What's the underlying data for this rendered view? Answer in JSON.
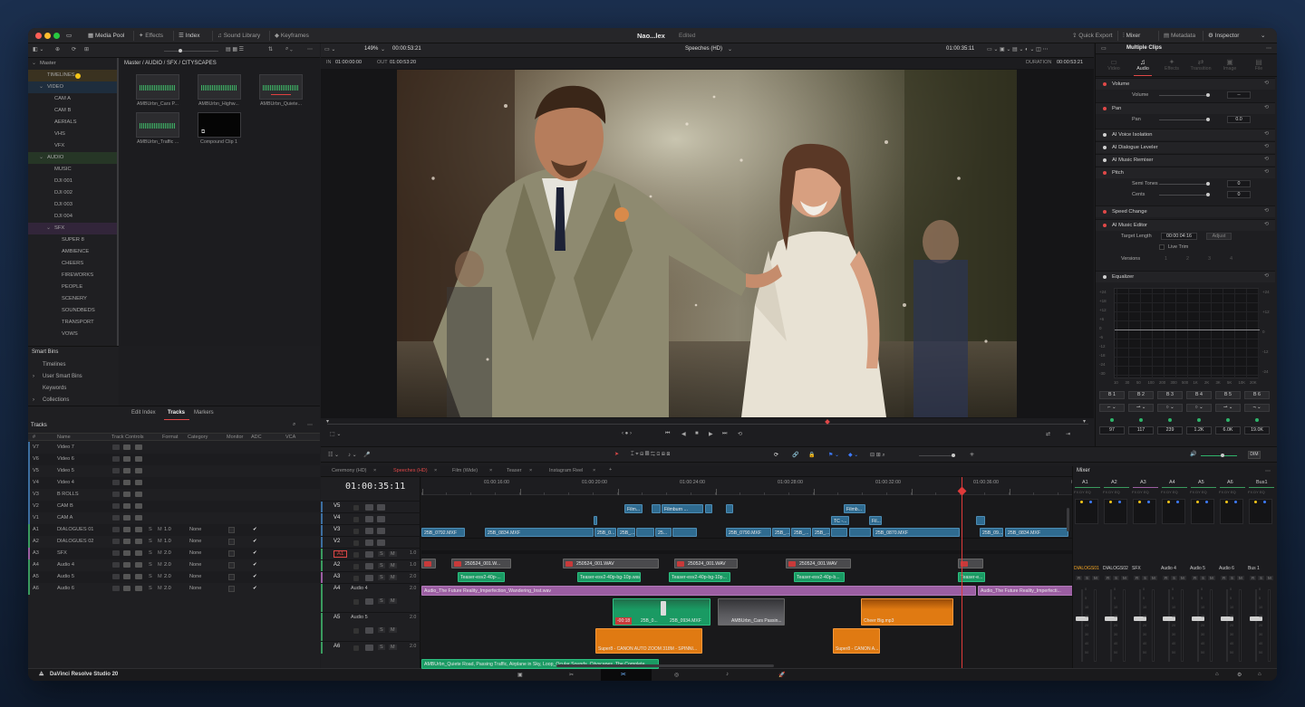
{
  "app": {
    "project_name": "Nao...lex",
    "status": "Edited",
    "brand": "DaVinci Resolve Studio 20"
  },
  "topbar": {
    "left": [
      "Media Pool",
      "Effects",
      "Index",
      "Sound Library",
      "Keyframes"
    ],
    "right": [
      "Quick Export",
      "Mixer",
      "Metadata",
      "Inspector"
    ]
  },
  "viewer": {
    "zoom": "149%",
    "timecode_in": "00:00:53:21",
    "timeline_name": "Speeches (HD)",
    "timecode_current": "01:00:35:11",
    "in_label": "IN",
    "in_tc": "01:00:00:00",
    "out_label": "OUT",
    "out_tc": "01:00:53:20",
    "duration_label": "DURATION",
    "duration_tc": "00:00:53:21"
  },
  "media_pool": {
    "breadcrumb": "Master / AUDIO / SFX / CITYSCAPES",
    "tree": [
      {
        "label": "Master",
        "indent": 0,
        "arrow": "v",
        "color": ""
      },
      {
        "label": "TIMELINES",
        "indent": 1,
        "arrow": "",
        "color": "#3a3220"
      },
      {
        "label": "VIDEO",
        "indent": 1,
        "arrow": "v",
        "color": "#1e2d3d"
      },
      {
        "label": "CAM A",
        "indent": 2,
        "arrow": "",
        "color": ""
      },
      {
        "label": "CAM B",
        "indent": 2,
        "arrow": "",
        "color": ""
      },
      {
        "label": "AERIALS",
        "indent": 2,
        "arrow": "",
        "color": ""
      },
      {
        "label": "VHS",
        "indent": 2,
        "arrow": "",
        "color": ""
      },
      {
        "label": "VFX",
        "indent": 2,
        "arrow": "",
        "color": ""
      },
      {
        "label": "AUDIO",
        "indent": 1,
        "arrow": "v",
        "color": "#263626"
      },
      {
        "label": "MUSIC",
        "indent": 2,
        "arrow": "",
        "color": ""
      },
      {
        "label": "DJI 001",
        "indent": 2,
        "arrow": "",
        "color": ""
      },
      {
        "label": "DJI 002",
        "indent": 2,
        "arrow": "",
        "color": ""
      },
      {
        "label": "DJI 003",
        "indent": 2,
        "arrow": "",
        "color": ""
      },
      {
        "label": "DJI 004",
        "indent": 2,
        "arrow": "",
        "color": ""
      },
      {
        "label": "SFX",
        "indent": 2,
        "arrow": "v",
        "color": "#32253a"
      },
      {
        "label": "SUPER 8",
        "indent": 3,
        "arrow": "",
        "color": ""
      },
      {
        "label": "AMBIENCE",
        "indent": 3,
        "arrow": "",
        "color": ""
      },
      {
        "label": "CHEERS",
        "indent": 3,
        "arrow": "",
        "color": ""
      },
      {
        "label": "FIREWORKS",
        "indent": 3,
        "arrow": "",
        "color": ""
      },
      {
        "label": "PEOPLE",
        "indent": 3,
        "arrow": "",
        "color": ""
      },
      {
        "label": "SCENERY",
        "indent": 3,
        "arrow": "",
        "color": ""
      },
      {
        "label": "SOUNDBEDS",
        "indent": 3,
        "arrow": "",
        "color": ""
      },
      {
        "label": "TRANSPORT",
        "indent": 3,
        "arrow": "",
        "color": ""
      },
      {
        "label": "VOWS",
        "indent": 3,
        "arrow": "",
        "color": ""
      }
    ],
    "clips": [
      "AMBUrbn_Cars P...",
      "AMBUrbn_Highw...",
      "AMBUrbn_Quiete...",
      "AMBUrbn_Traffic ...",
      "Compound Clip 1"
    ],
    "smart_bins_title": "Smart Bins",
    "smart_bins": [
      "Timelines",
      "User Smart Bins",
      "Keywords",
      "Collections"
    ]
  },
  "index": {
    "tabs": [
      "Edit Index",
      "Tracks",
      "Markers"
    ],
    "active_tab": "Tracks",
    "title": "Tracks",
    "columns": [
      "#",
      "Name",
      "Track Controls",
      "Format",
      "Category",
      "Monitor",
      "ADC",
      "VCA"
    ],
    "rows": [
      {
        "id": "V7",
        "name": "Video 7",
        "format": "",
        "category": "",
        "adc": ""
      },
      {
        "id": "V6",
        "name": "Video 6",
        "format": "",
        "category": "",
        "adc": ""
      },
      {
        "id": "V5",
        "name": "Video 5",
        "format": "",
        "category": "",
        "adc": ""
      },
      {
        "id": "V4",
        "name": "Video 4",
        "format": "",
        "category": "",
        "adc": ""
      },
      {
        "id": "V3",
        "name": "B ROLLS",
        "format": "",
        "category": "",
        "adc": ""
      },
      {
        "id": "V2",
        "name": "CAM B",
        "format": "",
        "category": "",
        "adc": ""
      },
      {
        "id": "V1",
        "name": "CAM A",
        "format": "",
        "category": "",
        "adc": ""
      },
      {
        "id": "A1",
        "name": "DIALOGUES 01",
        "format": "1.0",
        "category": "None",
        "adc": "✔"
      },
      {
        "id": "A2",
        "name": "DIALOGUES 02",
        "format": "1.0",
        "category": "None",
        "adc": "✔"
      },
      {
        "id": "A3",
        "name": "SFX",
        "format": "2.0",
        "category": "None",
        "adc": "✔"
      },
      {
        "id": "A4",
        "name": "Audio 4",
        "format": "2.0",
        "category": "None",
        "adc": "✔"
      },
      {
        "id": "A5",
        "name": "Audio 5",
        "format": "2.0",
        "category": "None",
        "adc": "✔"
      },
      {
        "id": "A6",
        "name": "Audio 6",
        "format": "2.0",
        "category": "None",
        "adc": "✔"
      }
    ]
  },
  "timeline": {
    "tabs": [
      "Ceremony (HD)",
      "Speeches (HD)",
      "Film (Wide)",
      "Teaser",
      "Instagram Reel"
    ],
    "active_tab": "Speeches (HD)",
    "timecode": "01:00:35:11",
    "ruler": [
      "01:00:16:00",
      "01:00:20:00",
      "01:00:24:00",
      "01:00:28:00",
      "01:00:32:00",
      "01:00:36:00",
      "01:00:40:00"
    ],
    "tracks": [
      {
        "id": "V5",
        "name": ""
      },
      {
        "id": "V4",
        "name": ""
      },
      {
        "id": "V3",
        "name": ""
      },
      {
        "id": "V2",
        "name": ""
      },
      {
        "id": "A1",
        "name": "",
        "fmt": "1.0"
      },
      {
        "id": "A2",
        "name": "",
        "fmt": "1.0"
      },
      {
        "id": "A3",
        "name": "",
        "fmt": "2.0"
      },
      {
        "id": "A4",
        "name": "Audio 4",
        "fmt": "2.0"
      },
      {
        "id": "A5",
        "name": "Audio 5",
        "fmt": "2.0"
      },
      {
        "id": "A6",
        "name": "",
        "fmt": "2.0"
      }
    ],
    "clip_labels": {
      "v5_a": "Film...",
      "v5_b": "Filmburn ...",
      "v5_c": "Filmb...",
      "v4_a": "TC -...",
      "v4_b": "Fil...",
      "v3": [
        "25B_0792.MXF",
        "25B_0834.MXF",
        "25B_0...",
        "25B_...",
        "25...",
        "25B_0790.MXF",
        "25B_...",
        "25B_...",
        "25B_...",
        "25B_0870.MXF",
        "25B_09...",
        "25B_0834.MXF"
      ],
      "a1": [
        "250524_001.W...",
        "250524_001.WAV",
        "250524_001.WAV",
        "250524_001.WAV"
      ],
      "a2": [
        "Teaser-esv2-40p-...",
        "Teaser-esv2-40p-bg-10p.wav",
        "Teaser-esv2-40p-bg-10p...",
        "Teaser-esv2-40p-b...",
        "Teaser-e..."
      ],
      "a3_a": "Audio_The Future Reality_Imperfection_Wandering_Inst.wav",
      "a3_b": "Audio_The Future Reality_Imperfecti...",
      "a4_red": "-00:18",
      "a4_a": "25B_0...",
      "a4_b": "25B_0934.MXF",
      "a4_c": "AMBUrbn_Cars Passin...",
      "a4_d": "Cheer Big.mp3",
      "a5_a": "Super8 - CANON AUTO ZOOM 318M - SPINNI...",
      "a5_b": "Super8 - CANON A...",
      "a6": "AMBUrbn_Quiete Road, Passing Traffic, Airplane in Sky, Loop_Ocular Sounds_Cityscapes_The Complete ..."
    }
  },
  "inspector": {
    "title": "Multiple Clips",
    "tabs": [
      "Video",
      "Audio",
      "Effects",
      "Transition",
      "Image",
      "File"
    ],
    "active_tab": "Audio",
    "volume_label": "Volume",
    "volume_sub": "Volume",
    "volume_value": "--",
    "pan_label": "Pan",
    "pan_sub": "Pan",
    "pan_value": "0.0",
    "voice_isolation": "AI Voice Isolation",
    "dialogue_leveler": "AI Dialogue Leveler",
    "music_remixer": "AI Music Remixer",
    "pitch_label": "Pitch",
    "semi_tones": "Semi Tones",
    "semi_value": "0",
    "cents": "Cents",
    "cents_value": "0",
    "speed_change": "Speed Change",
    "music_editor": "AI Music Editor",
    "target_length": "Target Length",
    "target_value": "00:00:04:16",
    "adjust": "Adjust",
    "live_trim": "Live Trim",
    "versions": "Versions",
    "version_numbers": [
      "1",
      "2",
      "3",
      "4"
    ],
    "equalizer": "Equalizer",
    "eq_db_left": [
      "+24",
      "+18",
      "+12",
      "+6",
      "0",
      "-6",
      "-12",
      "-18",
      "-24",
      "-30"
    ],
    "eq_db_right": [
      "+24",
      "+12",
      "0",
      "-12",
      "-24"
    ],
    "eq_freqs": [
      "10",
      "30",
      "50",
      "100",
      "200",
      "300",
      "500",
      "1K",
      "2K",
      "3K",
      "5K",
      "10K",
      "20K"
    ],
    "bands": [
      "B 1",
      "B 2",
      "B 3",
      "B 4",
      "B 5",
      "B 6"
    ],
    "band_values": [
      "97",
      "117",
      "239",
      "1.2K",
      "6.0K",
      "19.0K"
    ],
    "dim": "DIM"
  },
  "mixer": {
    "title": "Mixer",
    "channels": [
      "A1",
      "A2",
      "A3",
      "A4",
      "A5",
      "A6",
      "Bus1"
    ],
    "names": [
      "DIALOGS01",
      "DIALOGS02",
      "SFX",
      "Audio 4",
      "Audio 5",
      "Audio 6",
      "Bus 1"
    ],
    "fader_scale": [
      "0",
      "5",
      "10",
      "15",
      "20",
      "30",
      "40",
      "50"
    ],
    "meter_scale": [
      "0",
      "-5",
      "-10",
      "-15",
      "-20",
      "-30",
      "-40",
      "-50"
    ]
  }
}
